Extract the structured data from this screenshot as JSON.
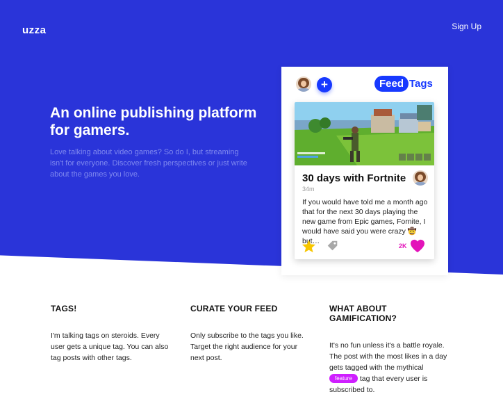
{
  "header": {
    "logo": "uzza",
    "signup_label": "Sign Up"
  },
  "hero": {
    "title": "An online publishing platform for gamers.",
    "subtitle": "Love talking about video games? So do I, but streaming isn't for everyone. Discover fresh perspectives or just write about the games you love."
  },
  "mockup": {
    "tabs": [
      "Feed",
      "Tags"
    ],
    "active_tab": "Feed",
    "post": {
      "title": "30 days with Fortnite",
      "time": "34m",
      "excerpt": "If you would have told me a month ago that for the next 30 days playing the new game from Epic games, Fornite, I would have said you were crazy 🤠but…",
      "likes": "2K"
    }
  },
  "features": [
    {
      "heading": "TAGS!",
      "text": "I'm talking tags on steroids. Every user gets a unique tag. You can also tag posts with other tags."
    },
    {
      "heading": "CURATE YOUR FEED",
      "text": "Only subscribe to the tags you like. Target the right audience for your next post."
    },
    {
      "heading": "WHAT ABOUT GAMIFICATION?",
      "text_before": "It's no fun unless it's a battle royale. The post with the most likes in a day gets tagged with the mythical",
      "badge": "feature",
      "text_after": "tag that every user is subscribed to."
    }
  ],
  "colors": {
    "hero_bg": "#2a34d9",
    "accent": "#1739ff",
    "badge": "#cf1fff",
    "like": "#e313b9",
    "star": "#f7c600"
  }
}
